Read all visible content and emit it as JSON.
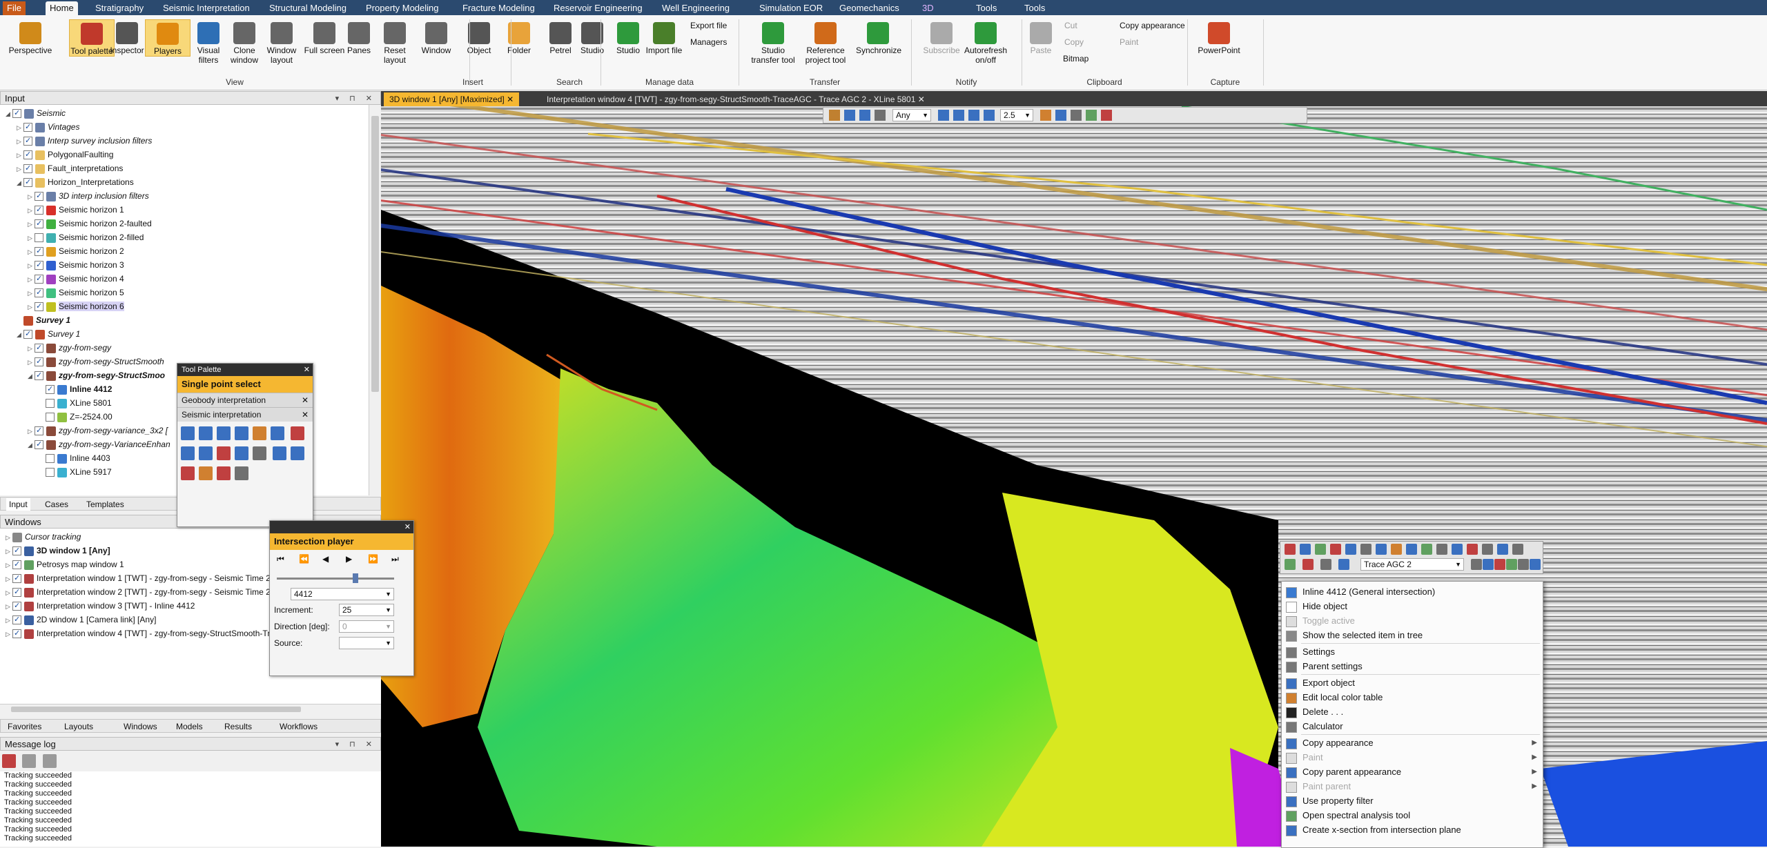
{
  "ribbon": {
    "tabs": [
      {
        "label": "File",
        "kind": "file"
      },
      {
        "label": "Home",
        "kind": "active"
      },
      {
        "label": "Stratigraphy",
        "kind": ""
      },
      {
        "label": "Seismic Interpretation",
        "kind": ""
      },
      {
        "label": "Structural Modeling",
        "kind": ""
      },
      {
        "label": "Property Modeling",
        "kind": ""
      },
      {
        "label": "Fracture Modeling",
        "kind": ""
      },
      {
        "label": "Reservoir Engineering",
        "kind": ""
      },
      {
        "label": "Well Engineering",
        "kind": ""
      },
      {
        "label": "Simulation",
        "kind": ""
      },
      {
        "label": "EOR",
        "kind": ""
      },
      {
        "label": "Geomechanics",
        "kind": ""
      },
      {
        "label": "3D",
        "kind": "purple"
      },
      {
        "label": "Tools",
        "kind": ""
      },
      {
        "label": "Tools",
        "kind": ""
      }
    ],
    "buttons": [
      {
        "label": "Perspective",
        "icon": "perspective-icon",
        "color": "#d08a1a",
        "state": ""
      },
      {
        "label": "Tool palette",
        "icon": "toolbox-icon",
        "color": "#c0392b",
        "state": "hl"
      },
      {
        "label": "Inspector",
        "icon": "inspector-icon",
        "color": "#555555",
        "state": ""
      },
      {
        "label": "Players",
        "icon": "players-icon",
        "color": "#e08a10",
        "state": "hl"
      },
      {
        "label": "Visual filters",
        "icon": "filter-icon",
        "color": "#2e6fb5",
        "state": ""
      },
      {
        "label": "Clone window",
        "icon": "clone-window-icon",
        "color": "#666666",
        "state": ""
      },
      {
        "label": "Window layout",
        "icon": "window-layout-icon",
        "color": "#666666",
        "state": ""
      },
      {
        "label": "Full screen",
        "icon": "full-screen-icon",
        "color": "#666666",
        "state": ""
      },
      {
        "label": "Panes",
        "icon": "panes-icon",
        "color": "#666666",
        "state": ""
      },
      {
        "label": "Reset layout",
        "icon": "reset-layout-icon",
        "color": "#666666",
        "state": ""
      },
      {
        "label": "Window",
        "icon": "window-icon",
        "color": "#666666",
        "state": ""
      },
      {
        "label": "Object",
        "icon": "object-icon",
        "color": "#555555",
        "state": ""
      },
      {
        "label": "Folder",
        "icon": "folder-icon",
        "color": "#e8a33a",
        "state": ""
      },
      {
        "label": "Petrel",
        "icon": "petrel-search-icon",
        "color": "#555555",
        "state": ""
      },
      {
        "label": "Studio",
        "icon": "studio-search-icon",
        "color": "#555555",
        "state": ""
      },
      {
        "label": "Studio",
        "icon": "studio-icon",
        "color": "#2e9a3c",
        "state": ""
      },
      {
        "label": "Import file",
        "icon": "import-file-icon",
        "color": "#4a7f2a",
        "state": ""
      },
      {
        "label": "Studio transfer tool",
        "icon": "studio-transfer-icon",
        "color": "#2e9a3c",
        "state": ""
      },
      {
        "label": "Reference project tool",
        "icon": "reference-project-icon",
        "color": "#d06a1a",
        "state": ""
      },
      {
        "label": "Synchronize",
        "icon": "synchronize-icon",
        "color": "#2e9a3c",
        "state": ""
      },
      {
        "label": "Subscribe",
        "icon": "subscribe-icon",
        "color": "#aaaaaa",
        "state": "dim"
      },
      {
        "label": "Autorefresh on/off",
        "icon": "autorefresh-icon",
        "color": "#2e9a3c",
        "state": ""
      },
      {
        "label": "Paste",
        "icon": "paste-icon",
        "color": "#aaaaaa",
        "state": "dim"
      },
      {
        "label": "PowerPoint",
        "icon": "powerpoint-icon",
        "color": "#d04a2a",
        "state": ""
      }
    ],
    "small": {
      "export_file": "Export file",
      "managers": "Managers",
      "cut": "Cut",
      "copy": "Copy",
      "bitmap": "Bitmap",
      "copy_appearance": "Copy appearance",
      "paint": "Paint"
    },
    "groups": [
      "View",
      "Insert",
      "Search",
      "Manage data",
      "Transfer",
      "Notify",
      "Clipboard",
      "Capture"
    ]
  },
  "input_panel": {
    "title": "Input",
    "items": [
      {
        "label": "Seismic",
        "style": "it",
        "indent": 0,
        "checked": true,
        "icon": "#6a7fa8",
        "exp": "◢"
      },
      {
        "label": "Vintages",
        "style": "it",
        "indent": 1,
        "checked": true,
        "icon": "#6a7fa8",
        "exp": "▷"
      },
      {
        "label": "Interp survey inclusion filters",
        "style": "it",
        "indent": 1,
        "checked": true,
        "icon": "#6a7fa8",
        "exp": "▷"
      },
      {
        "label": "PolygonalFaulting",
        "style": "",
        "indent": 1,
        "checked": true,
        "icon": "#e8c060",
        "exp": "▷"
      },
      {
        "label": "Fault_interpretations",
        "style": "",
        "indent": 1,
        "checked": true,
        "icon": "#e8c060",
        "exp": "▷"
      },
      {
        "label": "Horizon_Interpretations",
        "style": "",
        "indent": 1,
        "checked": true,
        "icon": "#e8c060",
        "exp": "◢"
      },
      {
        "label": "3D interp inclusion filters",
        "style": "it",
        "indent": 2,
        "checked": true,
        "icon": "#6a7fa8",
        "exp": "▷"
      },
      {
        "label": "Seismic horizon 1",
        "style": "",
        "indent": 2,
        "checked": true,
        "icon": "#d8302a",
        "exp": "▷"
      },
      {
        "label": "Seismic horizon 2-faulted",
        "style": "",
        "indent": 2,
        "checked": true,
        "icon": "#40b040",
        "exp": "▷"
      },
      {
        "label": "Seismic horizon 2-filled",
        "style": "",
        "indent": 2,
        "checked": false,
        "icon": "#40b0b0",
        "exp": "▷"
      },
      {
        "label": "Seismic horizon 2",
        "style": "",
        "indent": 2,
        "checked": true,
        "icon": "#e0a020",
        "exp": "▷"
      },
      {
        "label": "Seismic horizon 3",
        "style": "",
        "indent": 2,
        "checked": true,
        "icon": "#3060d0",
        "exp": "▷"
      },
      {
        "label": "Seismic horizon 4",
        "style": "",
        "indent": 2,
        "checked": true,
        "icon": "#a040c0",
        "exp": "▷"
      },
      {
        "label": "Seismic horizon 5",
        "style": "",
        "indent": 2,
        "checked": true,
        "icon": "#40c080",
        "exp": "▷"
      },
      {
        "label": "Seismic horizon 6",
        "style": "sel",
        "indent": 2,
        "checked": true,
        "icon": "#c0c020",
        "exp": "▷"
      },
      {
        "label": "Survey 1",
        "style": "it bd",
        "indent": 1,
        "checked": null,
        "icon": "#c04a2a",
        "exp": ""
      },
      {
        "label": "Survey 1",
        "style": "it",
        "indent": 1,
        "checked": true,
        "icon": "#c04a2a",
        "exp": "◢"
      },
      {
        "label": "zgy-from-segy",
        "style": "it",
        "indent": 2,
        "checked": true,
        "icon": "#8a4a3a",
        "exp": "▷"
      },
      {
        "label": "zgy-from-segy-StructSmooth",
        "style": "it",
        "indent": 2,
        "checked": true,
        "icon": "#8a4a3a",
        "exp": "▷"
      },
      {
        "label": "zgy-from-segy-StructSmoo",
        "style": "it bd",
        "indent": 2,
        "checked": true,
        "icon": "#8a4a3a",
        "exp": "◢"
      },
      {
        "label": "Inline 4412",
        "style": "bd",
        "indent": 3,
        "checked": true,
        "icon": "#3a7ad0",
        "exp": ""
      },
      {
        "label": "XLine 5801",
        "style": "",
        "indent": 3,
        "checked": false,
        "icon": "#3ab0d0",
        "exp": ""
      },
      {
        "label": "Z=-2524.00",
        "style": "",
        "indent": 3,
        "checked": false,
        "icon": "#90c040",
        "exp": ""
      },
      {
        "label": "zgy-from-segy-variance_3x2 [",
        "style": "it",
        "indent": 2,
        "checked": true,
        "icon": "#8a4a3a",
        "exp": "▷"
      },
      {
        "label": "zgy-from-segy-VarianceEnhan",
        "style": "it",
        "indent": 2,
        "checked": true,
        "icon": "#8a4a3a",
        "exp": "◢"
      },
      {
        "label": "Inline 4403",
        "style": "",
        "indent": 3,
        "checked": false,
        "icon": "#3a7ad0",
        "exp": ""
      },
      {
        "label": "XLine 5917",
        "style": "",
        "indent": 3,
        "checked": false,
        "icon": "#3ab0d0",
        "exp": ""
      }
    ],
    "tabs": [
      "Input",
      "Cases",
      "Templates"
    ]
  },
  "windows_panel": {
    "title": "Windows",
    "items": [
      {
        "label": "Cursor tracking",
        "style": "it",
        "checked": null,
        "icon": "#888888"
      },
      {
        "label": "3D window 1 [Any]",
        "style": "bd",
        "checked": true,
        "icon": "#3a60a0"
      },
      {
        "label": "Petrosys map window 1",
        "style": "",
        "checked": true,
        "icon": "#60a060"
      },
      {
        "label": "Interpretation window 1 [TWT] - zgy-from-segy - Seismic Time 2",
        "style": "",
        "checked": true,
        "icon": "#b04040"
      },
      {
        "label": "Interpretation window 2 [TWT] - zgy-from-segy - Seismic Time 2",
        "style": "",
        "checked": true,
        "icon": "#b04040"
      },
      {
        "label": "Interpretation window 3 [TWT] - Inline 4412",
        "style": "",
        "checked": true,
        "icon": "#b04040"
      },
      {
        "label": "2D window 1 [Camera link] [Any]",
        "style": "",
        "checked": true,
        "icon": "#3a60a0"
      },
      {
        "label": "Interpretation window 4 [TWT] - zgy-from-segy-StructSmooth-Tr",
        "style": "",
        "checked": true,
        "icon": "#b04040"
      }
    ],
    "tabs": [
      "Favorites",
      "Layouts",
      "Windows",
      "Models",
      "Results",
      "Workflows"
    ]
  },
  "message_log": {
    "title": "Message log",
    "lines": [
      "Tracking succeeded",
      "Tracking succeeded",
      "Tracking succeeded",
      "Tracking succeeded",
      "Tracking succeeded",
      "Tracking succeeded",
      "Tracking succeeded",
      "Tracking succeeded"
    ]
  },
  "doc_tabs": [
    {
      "label": "3D window 1 [Any] [Maximized]",
      "active": true
    },
    {
      "label": "Interpretation window 4 [TWT] - zgy-from-segy-StructSmooth-TraceAGC - Trace AGC 2 - XLine 5801",
      "active": false
    }
  ],
  "viewer_toolbar": {
    "any_label": "Any",
    "zoom_value": "2.5"
  },
  "tool_palette": {
    "title": "Tool Palette",
    "selected_tool": "Single point select",
    "sections": [
      "Geobody interpretation",
      "Seismic interpretation"
    ]
  },
  "intersection_player": {
    "title": "Intersection player",
    "line_value": "4412",
    "increment_label": "Increment:",
    "increment_value": "25",
    "direction_label": "Direction [deg]:",
    "direction_value": "0",
    "source_label": "Source:"
  },
  "context_toolbar": {
    "dropdown_value": "Trace AGC 2"
  },
  "context_menu": {
    "items": [
      {
        "label": "Inline 4412 (General intersection)",
        "state": "",
        "icon": "#3a7ad0",
        "sep_after": false,
        "arrow": false
      },
      {
        "label": "Hide object",
        "state": "",
        "icon": "#ffffff",
        "sep_after": false,
        "arrow": false
      },
      {
        "label": "Toggle active",
        "state": "dim",
        "icon": "#dddddd",
        "sep_after": false,
        "arrow": false
      },
      {
        "label": "Show the selected item in tree",
        "state": "",
        "icon": "#888888",
        "sep_after": true,
        "arrow": false
      },
      {
        "label": "Settings",
        "state": "",
        "icon": "#777777",
        "sep_after": false,
        "arrow": false
      },
      {
        "label": "Parent settings",
        "state": "",
        "icon": "#777777",
        "sep_after": true,
        "arrow": false
      },
      {
        "label": "Export object",
        "state": "",
        "icon": "#3a70c0",
        "sep_after": false,
        "arrow": false
      },
      {
        "label": "Edit local color table",
        "state": "",
        "icon": "#d08030",
        "sep_after": false,
        "arrow": false
      },
      {
        "label": "Delete . . .",
        "state": "",
        "icon": "#222222",
        "sep_after": false,
        "arrow": false
      },
      {
        "label": "Calculator",
        "state": "",
        "icon": "#777777",
        "sep_after": true,
        "arrow": false
      },
      {
        "label": "Copy appearance",
        "state": "",
        "icon": "#3a70c0",
        "sep_after": false,
        "arrow": true
      },
      {
        "label": "Paint",
        "state": "dim",
        "icon": "#dddddd",
        "sep_after": false,
        "arrow": true
      },
      {
        "label": "Copy parent appearance",
        "state": "",
        "icon": "#3a70c0",
        "sep_after": false,
        "arrow": true
      },
      {
        "label": "Paint parent",
        "state": "dim",
        "icon": "#dddddd",
        "sep_after": false,
        "arrow": true
      },
      {
        "label": "Use property filter",
        "state": "",
        "icon": "#3a70c0",
        "sep_after": false,
        "arrow": false
      },
      {
        "label": "Open spectral analysis tool",
        "state": "",
        "icon": "#60a060",
        "sep_after": false,
        "arrow": false
      },
      {
        "label": "Create x-section from intersection plane",
        "state": "",
        "icon": "#3a70c0",
        "sep_after": false,
        "arrow": false
      }
    ]
  },
  "colors": {
    "accent": "#f5b731",
    "ribbon_bar": "#2b4a6f",
    "file_tab": "#c85a19"
  }
}
